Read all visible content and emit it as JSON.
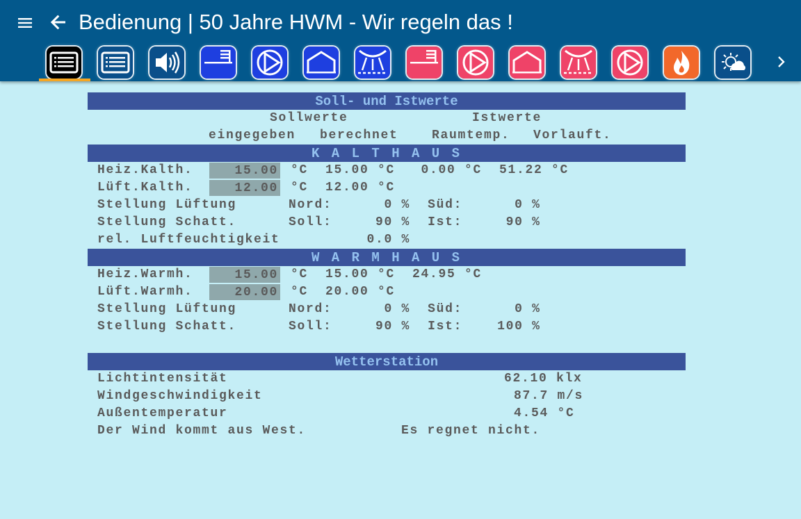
{
  "app": {
    "title": "Bedienung | 50 Jahre HWM - Wir regeln das !"
  },
  "tabs": [
    {
      "name": "overview-list",
      "icon": "list-icon",
      "active": true
    },
    {
      "name": "list-2",
      "icon": "list-icon",
      "active": false
    },
    {
      "name": "sound",
      "icon": "speaker-icon",
      "active": false
    },
    {
      "name": "kalthaus-shading",
      "icon": "shade-icon",
      "active": false
    },
    {
      "name": "kalthaus-valve",
      "icon": "pump-icon",
      "active": false
    },
    {
      "name": "kalthaus-house",
      "icon": "greenhouse-icon",
      "active": false
    },
    {
      "name": "kalthaus-vent",
      "icon": "ventilation-icon",
      "active": false
    },
    {
      "name": "warmhaus-shading",
      "icon": "shade-icon",
      "active": false
    },
    {
      "name": "warmhaus-valve",
      "icon": "pump-icon",
      "active": false
    },
    {
      "name": "warmhaus-house",
      "icon": "greenhouse-icon",
      "active": false
    },
    {
      "name": "warmhaus-vent",
      "icon": "ventilation-icon",
      "active": false
    },
    {
      "name": "warmhaus-pump",
      "icon": "pump-icon",
      "active": false
    },
    {
      "name": "heating",
      "icon": "flame-icon",
      "active": false
    },
    {
      "name": "weather",
      "icon": "sun-cloud-icon",
      "active": false
    }
  ],
  "colors": {
    "appbar": "#03588c",
    "accent": "#f5a623",
    "section": "#3a539b",
    "section_text": "#94c1ef",
    "body": "#c5eef6",
    "input": "#8fa8ab"
  },
  "sections": {
    "soll_ist": {
      "title": "Soll- und Istwerte",
      "sollwerte": "Sollwerte",
      "istwerte": "Istwerte",
      "eingegeben": "eingegeben",
      "berechnet": "berechnet",
      "raumtemp": "Raumtemp.",
      "vorlauft": "Vorlauft."
    },
    "kalthaus": {
      "title": "K A L T H A U S",
      "heiz_label": "Heiz.Kalth.",
      "heiz_input": "15.00",
      "heiz_calc": "°C  15.00 °C   0.00 °C  51.22 °C",
      "lueft_label": "Lüft.Kalth.",
      "lueft_input": "12.00",
      "lueft_calc": "°C  12.00 °C",
      "stell_lueft": "Stellung Lüftung      Nord:      0 %  Süd:      0 %",
      "stell_schatt": "Stellung Schatt.      Soll:     90 %  Ist:     90 %",
      "luftfeuchte": "rel. Luftfeuchtigkeit          0.0 %"
    },
    "warmhaus": {
      "title": "W A R M H A U S",
      "heiz_label": "Heiz.Warmh.",
      "heiz_input": "15.00",
      "heiz_calc": "°C  15.00 °C  24.95 °C",
      "lueft_label": "Lüft.Warmh.",
      "lueft_input": "20.00",
      "lueft_calc": "°C  20.00 °C",
      "stell_lueft": "Stellung Lüftung      Nord:      0 %  Süd:      0 %",
      "stell_schatt": "Stellung Schatt.      Soll:     90 %  Ist:    100 %"
    },
    "wetter": {
      "title": "Wetterstation",
      "licht_label": "Lichtintensität",
      "licht_value": "62.10 klx",
      "wind_label": "Windgeschwindigkeit",
      "wind_value": "87.7 m/s",
      "aussen_label": "Außentemperatur",
      "aussen_value": "4.54 °C",
      "wind_dir": "Der Wind kommt aus West.",
      "regen": "Es regnet nicht."
    }
  }
}
